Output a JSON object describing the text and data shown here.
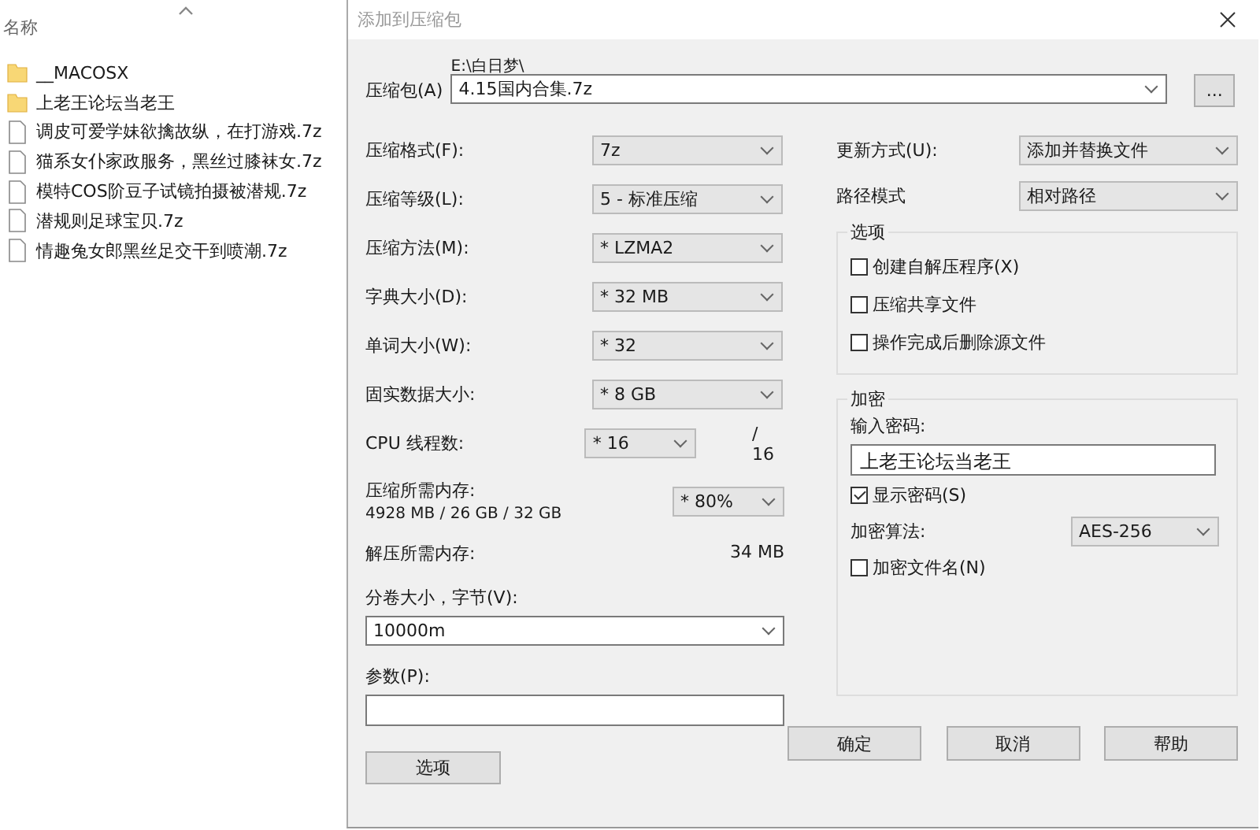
{
  "explorer": {
    "column_header": "名称",
    "items": [
      {
        "kind": "folder",
        "name": "__MACOSX"
      },
      {
        "kind": "folder",
        "name": "上老王论坛当老王"
      },
      {
        "kind": "file",
        "name": "调皮可爱学妹欲擒故纵，在打游戏.7z"
      },
      {
        "kind": "file",
        "name": "猫系女仆家政服务，黑丝过膝袜女.7z"
      },
      {
        "kind": "file",
        "name": "模特COS阶豆子试镜拍摄被潜规.7z"
      },
      {
        "kind": "file",
        "name": "潜规则足球宝贝.7z"
      },
      {
        "kind": "file",
        "name": "情趣兔女郎黑丝足交干到喷潮.7z"
      }
    ]
  },
  "window": {
    "title": "添加到压缩包"
  },
  "archive": {
    "label": "压缩包(A)",
    "path": "E:\\白日梦\\",
    "value": "4.15国内合集.7z",
    "browse": "..."
  },
  "settings": [
    {
      "label": "压缩格式(F):",
      "value": "7z"
    },
    {
      "label": "压缩等级(L):",
      "value": "5 - 标准压缩"
    },
    {
      "label": "压缩方法(M):",
      "value": "* LZMA2"
    },
    {
      "label": "字典大小(D):",
      "value": "* 32 MB"
    },
    {
      "label": "单词大小(W):",
      "value": "* 32"
    },
    {
      "label": "固实数据大小:",
      "value": "* 8 GB"
    }
  ],
  "cpu": {
    "label": "CPU 线程数:",
    "value": "* 16",
    "max": "/ 16"
  },
  "memory": {
    "label": "压缩所需内存:",
    "detail": "4928 MB / 26 GB / 32 GB",
    "value": "* 80%"
  },
  "decompress": {
    "label": "解压所需内存:",
    "value": "34 MB"
  },
  "volume": {
    "label": "分卷大小，字节(V):",
    "value": "10000m"
  },
  "params": {
    "label": "参数(P):"
  },
  "options_button": "选项",
  "update": {
    "label": "更新方式(U):",
    "value": "添加并替换文件"
  },
  "path_mode": {
    "label": "路径模式",
    "value": "相对路径"
  },
  "options": {
    "title": "选项",
    "items": [
      {
        "label": "创建自解压程序(X)",
        "checked": false
      },
      {
        "label": "压缩共享文件",
        "checked": false
      },
      {
        "label": "操作完成后删除源文件",
        "checked": false
      }
    ]
  },
  "encryption": {
    "title": "加密",
    "password_label": "输入密码:",
    "password": "上老王论坛当老王",
    "show_password": {
      "label": "显示密码(S)",
      "checked": true
    },
    "method_label": "加密算法:",
    "method": "AES-256",
    "encrypt_names": {
      "label": "加密文件名(N)",
      "checked": false
    }
  },
  "buttons": [
    "确定",
    "取消",
    "帮助"
  ]
}
